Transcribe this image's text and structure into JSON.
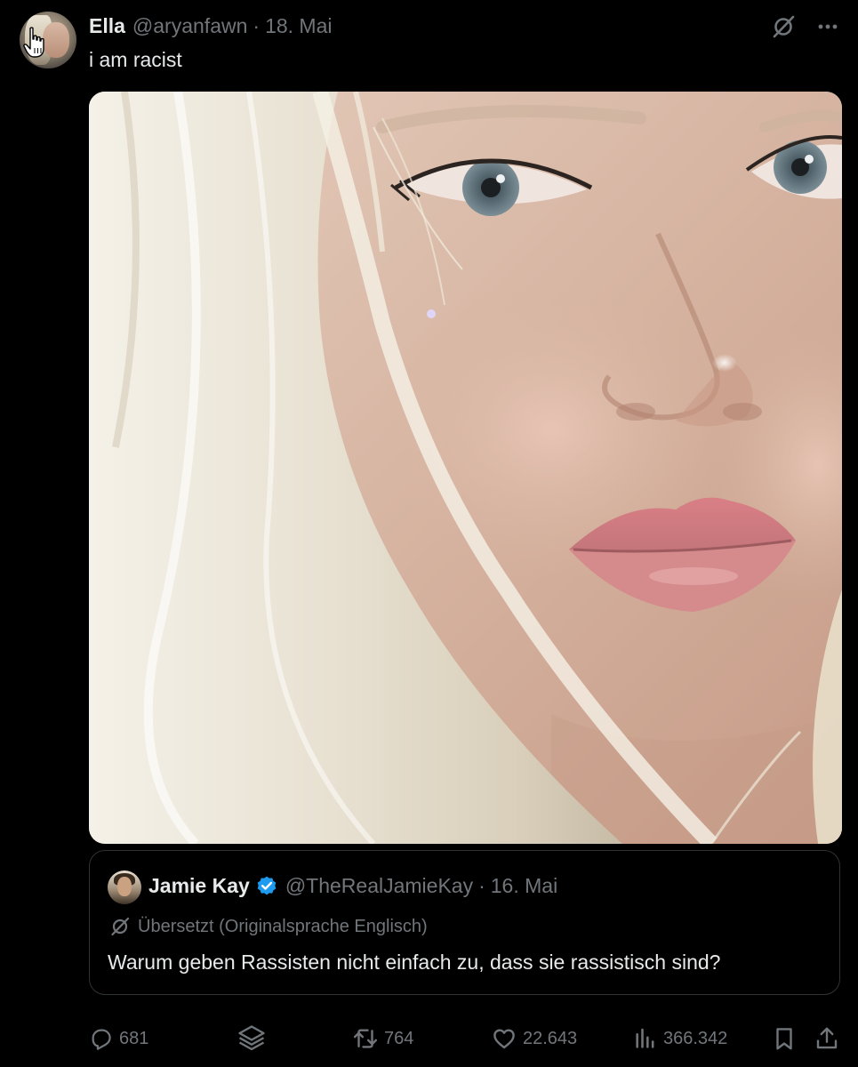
{
  "post": {
    "author": {
      "display_name": "Ella",
      "handle": "@aryanfawn",
      "separator": "·",
      "date": "18. Mai"
    },
    "text": "i am racist",
    "top_icons": [
      "translate-icon",
      "more-icon"
    ],
    "media": {
      "kind": "photo"
    }
  },
  "quote": {
    "author": {
      "display_name": "Jamie Kay",
      "handle": "@TheRealJamieKay",
      "separator": "·",
      "date": "16. Mai",
      "verified": true
    },
    "translated_label": "Übersetzt (Originalsprache Englisch)",
    "text": "Warum geben Rassisten nicht einfach zu, dass sie rassistisch sind?"
  },
  "actions": {
    "replies": "681",
    "retweets": "764",
    "likes": "22.643",
    "views": "366.342"
  },
  "colors": {
    "background": "#000000",
    "text_primary": "#e7e9ea",
    "text_secondary": "#71767b",
    "border": "#2f3336",
    "verified": "#1d9bf0"
  }
}
